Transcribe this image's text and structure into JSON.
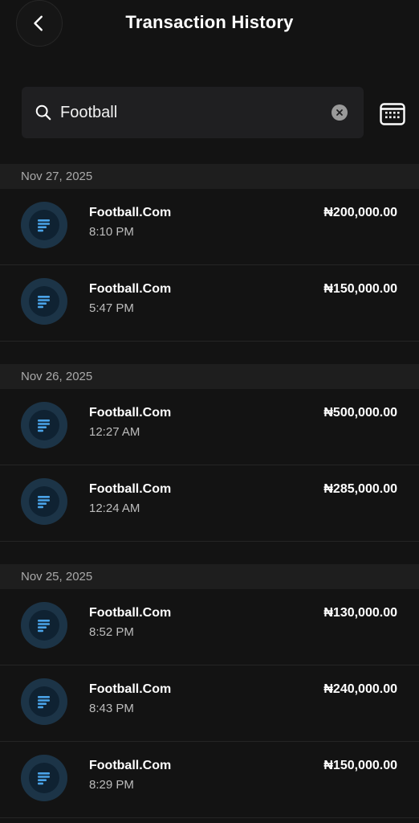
{
  "header": {
    "title": "Transaction History"
  },
  "search": {
    "value": "Football"
  },
  "groups": [
    {
      "date": "Nov 27, 2025",
      "transactions": [
        {
          "name": "Football.Com",
          "time": "8:10 PM",
          "amount": "₦200,000.00"
        },
        {
          "name": "Football.Com",
          "time": "5:47 PM",
          "amount": "₦150,000.00"
        }
      ]
    },
    {
      "date": "Nov 26, 2025",
      "transactions": [
        {
          "name": "Football.Com",
          "time": "12:27 AM",
          "amount": "₦500,000.00"
        },
        {
          "name": "Football.Com",
          "time": "12:24 AM",
          "amount": "₦285,000.00"
        }
      ]
    },
    {
      "date": "Nov 25, 2025",
      "transactions": [
        {
          "name": "Football.Com",
          "time": "8:52 PM",
          "amount": "₦130,000.00"
        },
        {
          "name": "Football.Com",
          "time": "8:43 PM",
          "amount": "₦240,000.00"
        },
        {
          "name": "Football.Com",
          "time": "8:29 PM",
          "amount": "₦150,000.00"
        }
      ]
    }
  ],
  "icons": {
    "back": "chevron-left-icon",
    "search": "search-icon",
    "clear": "clear-icon",
    "calendar": "calendar-icon",
    "transaction": "document-lines-icon"
  },
  "colors": {
    "background": "#131313",
    "section_header": "#1e1e1e",
    "icon_ring": "#1c3447",
    "icon_accent": "#4aa3e8"
  }
}
